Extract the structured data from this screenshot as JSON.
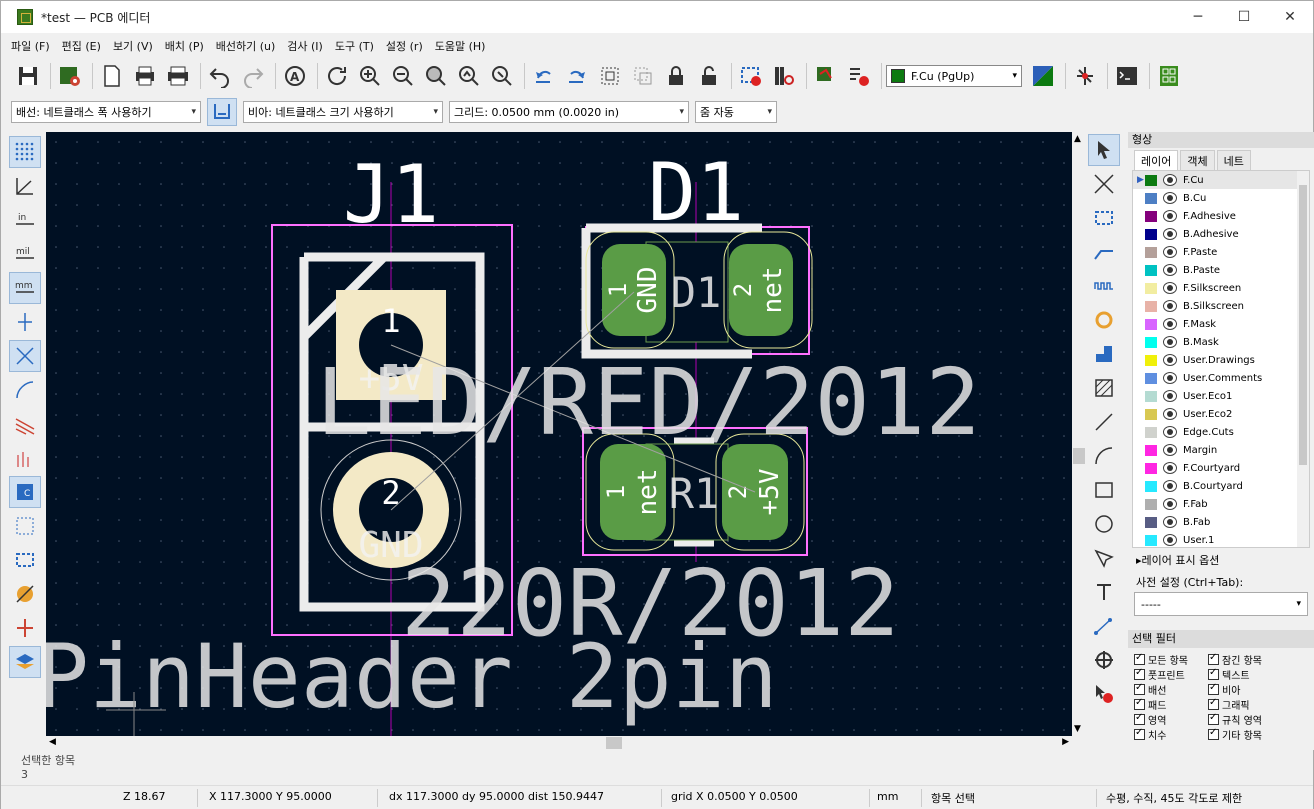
{
  "window": {
    "title": "*test — PCB 에디터",
    "controls": [
      "─",
      "☐",
      "✕"
    ]
  },
  "menu": [
    "파일 (F)",
    "편집 (E)",
    "보기 (V)",
    "배치 (P)",
    "배선하기 (u)",
    "검사 (I)",
    "도구 (T)",
    "설정 (r)",
    "도움말 (H)"
  ],
  "toolbar": {
    "active_layer": "F.Cu (PgUp)",
    "active_layer_color": "#0c7a10"
  },
  "toolbar2": {
    "track": "배선: 네트클래스 폭 사용하기",
    "via": "비아: 네트클래스 크기 사용하기",
    "grid": "그리드: 0.0500 mm (0.0020 in)",
    "zoom": "줌 자동"
  },
  "canvas": {
    "ref_j1": "J1",
    "ref_d1": "D1",
    "pad_j1_1_num": "1",
    "pad_j1_1_net": "+5V",
    "pad_j1_2_num": "2",
    "pad_j1_2_net": "GND",
    "d1_pad1_num": "1",
    "d1_pad1_net": "GND",
    "d1_label": "D1",
    "d1_pad2_num": "2",
    "d1_pad2_net": "net",
    "r1_pad1_num": "1",
    "r1_pad1_net": "net",
    "r1_label": "R1",
    "r1_pad2_num": "2",
    "r1_pad2_net": "+5V",
    "value_d1": "LED/RED/2012",
    "value_r1": "220R/2012",
    "value_j1": "PinHeader 2pin"
  },
  "panel": {
    "title": "형상",
    "tabs": [
      "레이어",
      "객체",
      "네트"
    ],
    "layers": [
      {
        "name": "F.Cu",
        "color": "#0c7a10"
      },
      {
        "name": "B.Cu",
        "color": "#4d7fc4"
      },
      {
        "name": "F.Adhesive",
        "color": "#84007c"
      },
      {
        "name": "B.Adhesive",
        "color": "#00008c"
      },
      {
        "name": "F.Paste",
        "color": "#b4a09a"
      },
      {
        "name": "B.Paste",
        "color": "#00c2c2"
      },
      {
        "name": "F.Silkscreen",
        "color": "#f2eda1"
      },
      {
        "name": "B.Silkscreen",
        "color": "#e8b2a7"
      },
      {
        "name": "F.Mask",
        "color": "#d864ff"
      },
      {
        "name": "B.Mask",
        "color": "#02ffee"
      },
      {
        "name": "User.Drawings",
        "color": "#f0f00a"
      },
      {
        "name": "User.Comments",
        "color": "#5f8fe0"
      },
      {
        "name": "User.Eco1",
        "color": "#b4dbd2"
      },
      {
        "name": "User.Eco2",
        "color": "#d8c852"
      },
      {
        "name": "Edge.Cuts",
        "color": "#d0d2cd"
      },
      {
        "name": "Margin",
        "color": "#ff26e2"
      },
      {
        "name": "F.Courtyard",
        "color": "#ff26e2"
      },
      {
        "name": "B.Courtyard",
        "color": "#26e9ff"
      },
      {
        "name": "F.Fab",
        "color": "#afafaf"
      },
      {
        "name": "B.Fab",
        "color": "#585d84"
      },
      {
        "name": "User.1",
        "color": "#26e9ff"
      }
    ],
    "layer_options": "▸레이어 표시 옵션",
    "preset_label": "사전 설정 (Ctrl+Tab):",
    "preset_value": "-----",
    "filter_title": "선택 필터",
    "filters": [
      "모든 항목",
      "잠긴 항목",
      "풋프린트",
      "텍스트",
      "배선",
      "비아",
      "패드",
      "그래픽",
      "영역",
      "규칙 영역",
      "치수",
      "기타 항목"
    ]
  },
  "messages": {
    "line1": "선택한 항목",
    "line2": "3"
  },
  "status": {
    "zoom": "Z 18.67",
    "xy": "X 117.3000  Y 95.0000",
    "delta": "dx 117.3000  dy 95.0000  dist 150.9447",
    "grid": "grid X 0.0500  Y 0.0500",
    "units": "mm",
    "mode": "항목 선택",
    "constraint": "수평, 수직, 45도 각도로 제한"
  }
}
